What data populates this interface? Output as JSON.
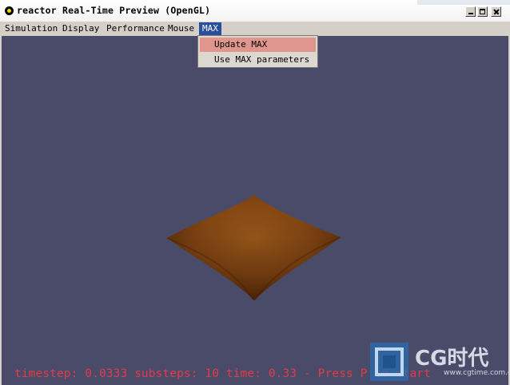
{
  "window": {
    "title": "reactor Real-Time Preview (OpenGL)"
  },
  "menubar": {
    "items": [
      {
        "label": "Simulation"
      },
      {
        "label": "Display"
      },
      {
        "label": "Performance"
      },
      {
        "label": "Mouse"
      },
      {
        "label": "MAX"
      }
    ]
  },
  "dropdown": {
    "items": [
      {
        "label": "Update MAX",
        "highlighted": true
      },
      {
        "label": "Use MAX parameters"
      }
    ]
  },
  "status": {
    "text": "timestep: 0.0333 substeps: 10 time: 0.33 - Press P to start"
  },
  "watermark": {
    "logo": "CG时代",
    "url": "www.cgtime.com.cn"
  },
  "colors": {
    "viewport": "#494b69",
    "object": "#8a4a14",
    "status_text": "#e03c4c",
    "menu_highlight": "#2a4e9c",
    "dropdown_highlight": "#e0968c"
  }
}
